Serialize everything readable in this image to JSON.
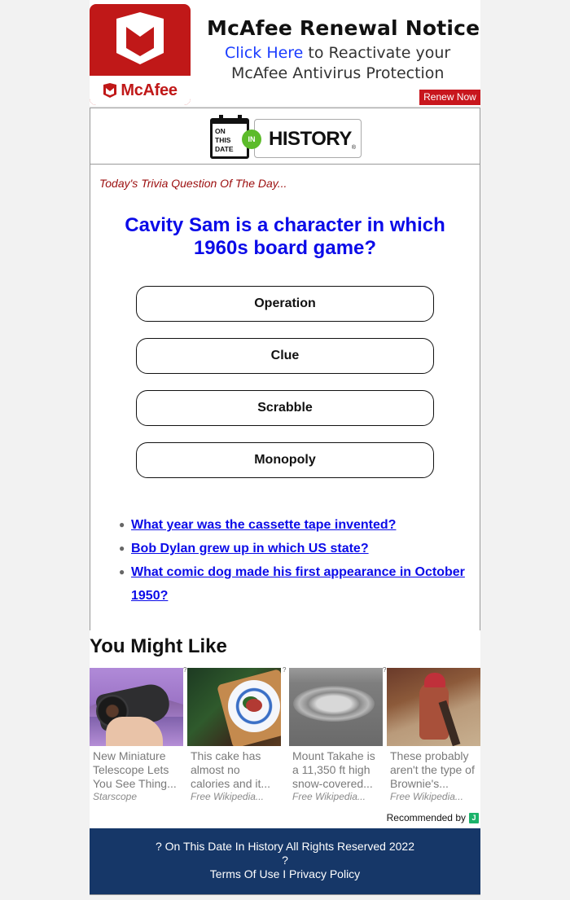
{
  "ad": {
    "brand": "McAfee",
    "title": "McAfee Renewal Notice",
    "click_here": "Click Here",
    "line2_rest": " to Reactivate your",
    "line3": "McAfee Antivirus Protection",
    "renew_button": "Renew Now",
    "colors": {
      "brand_red": "#c01818",
      "link_blue": "#1a3cff"
    }
  },
  "logo": {
    "calendar_text": [
      "ON",
      "THIS",
      "DATE"
    ],
    "in_badge": "IN",
    "history_text": "HISTORY",
    "registered_mark": "®",
    "colors": {
      "in_green": "#5cbb2a"
    }
  },
  "trivia": {
    "label": "Today's Trivia Question Of The Day...",
    "question": "Cavity Sam is a character in which 1960s board game?",
    "answers": [
      "Operation",
      "Clue",
      "Scrabble",
      "Monopoly"
    ],
    "colors": {
      "label": "#9b0d0d",
      "question": "#0b0be8"
    }
  },
  "related_questions": [
    "What year was the cassette tape invented?",
    "Bob Dylan grew up in which US state?",
    "What comic dog made his first appearance in October 1950?"
  ],
  "you_might_like": {
    "title": "You Might Like",
    "tiles": [
      {
        "image": "telescope-thumbnail",
        "caption": "New Miniature Telescope Lets You See Thing...",
        "source": "Starscope",
        "marker": ""
      },
      {
        "image": "cake-thumbnail",
        "caption": "This cake has almost no calories and it...",
        "source": "Free Wikipedia...",
        "marker": "?"
      },
      {
        "image": "mountain-thumbnail",
        "caption": "Mount Takahe is a 11,350 ft high snow-covered...",
        "source": "Free Wikipedia...",
        "marker": "?"
      },
      {
        "image": "brownie-thumbnail",
        "caption": "These probably aren't the type of Brownie's...",
        "source": "Free Wikipedia...",
        "marker": "?"
      }
    ],
    "recommended_by": "Recommended by",
    "recommender_logo": "J"
  },
  "footer": {
    "copyright": "? On This Date In History All Rights Reserved 2022",
    "separator": "?",
    "terms": "Terms Of Use",
    "divider": " I ",
    "privacy": "Privacy Policy",
    "colors": {
      "background": "#163768"
    }
  }
}
